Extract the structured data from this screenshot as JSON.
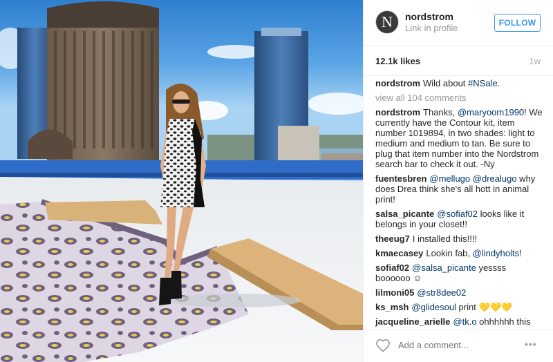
{
  "account": {
    "username": "nordstrom",
    "sublink": "Link in profile",
    "avatar_letter": "N",
    "follow_label": "FOLLOW"
  },
  "stats": {
    "likes": "12.1k likes",
    "age": "1w"
  },
  "caption": {
    "user": "nordstrom",
    "text": "Wild about ",
    "hashtag": "#NSale."
  },
  "view_all": "view all 104 comments",
  "comments": [
    {
      "user": "nordstrom",
      "parts": [
        {
          "t": "Thanks, "
        },
        {
          "m": "@maryoom1990"
        },
        {
          "t": "! We currently have the Contour kit, item number 1019894, in two shades: light to medium and medium to tan. Be sure to plug that item number into the Nordstrom search bar to check it out. -Ny"
        }
      ]
    },
    {
      "user": "fuentesbren",
      "parts": [
        {
          "m": "@mellugo"
        },
        {
          "t": " "
        },
        {
          "m": "@drealugo"
        },
        {
          "t": " why does Drea think she's all hott in animal print!"
        }
      ]
    },
    {
      "user": "salsa_picante",
      "parts": [
        {
          "m": "@sofiaf02"
        },
        {
          "t": " looks like it belongs in your closet!!"
        }
      ]
    },
    {
      "user": "theeug7",
      "parts": [
        {
          "t": "I installed this!!!!"
        }
      ]
    },
    {
      "user": "kmaecasey",
      "parts": [
        {
          "t": "Lookin fab, "
        },
        {
          "m": "@lindyholts"
        },
        {
          "t": "!"
        }
      ]
    },
    {
      "user": "sofiaf02",
      "parts": [
        {
          "m": "@salsa_picante"
        },
        {
          "t": " yessss boooooo ☺"
        }
      ]
    },
    {
      "user": "lilmoni05",
      "parts": [
        {
          "m": "@str8dee02"
        }
      ]
    },
    {
      "user": "ks_msh",
      "parts": [
        {
          "m": "@glidesoul"
        },
        {
          "t": " print 💛💛💛"
        }
      ]
    },
    {
      "user": "jacqueline_arielle",
      "parts": [
        {
          "m": "@tk.o"
        },
        {
          "t": " ohhhhhh this"
        }
      ]
    }
  ],
  "footer": {
    "add_comment_placeholder": "Add a comment...",
    "more_label": "•••"
  },
  "colors": {
    "link_blue": "#003569",
    "follow_blue": "#3897f0",
    "muted": "#999999"
  },
  "icons": [
    "heart-icon",
    "more-options-icon"
  ]
}
